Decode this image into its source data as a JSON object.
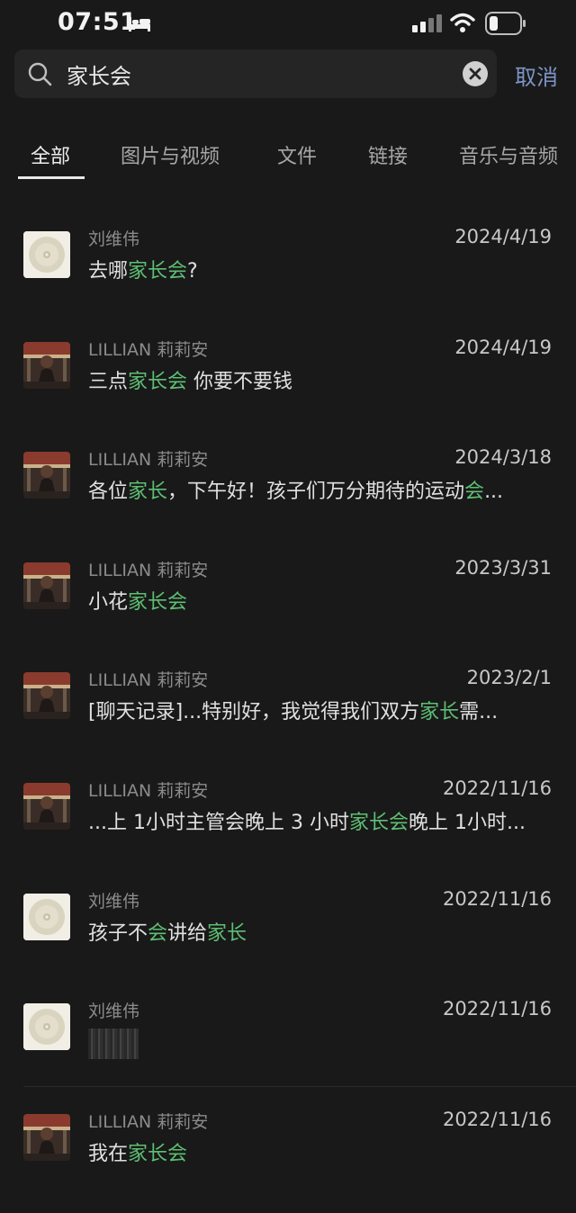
{
  "status_bar": {
    "time": "07:51"
  },
  "search": {
    "query": "家长会",
    "cancel_label": "取消"
  },
  "tabs": [
    {
      "label": "全部",
      "active": true
    },
    {
      "label": "图片与视频",
      "active": false
    },
    {
      "label": "文件",
      "active": false
    },
    {
      "label": "链接",
      "active": false
    },
    {
      "label": "音乐与音频",
      "active": false
    }
  ],
  "colors": {
    "background": "#191919",
    "highlight": "#5dbf73",
    "cancel": "#7c95c6"
  },
  "results": [
    {
      "sender": "刘维伟",
      "date": "2024/4/19",
      "avatar": "disc",
      "snippet": [
        {
          "t": "去哪"
        },
        {
          "t": "家长会",
          "hl": true
        },
        {
          "t": "?"
        }
      ]
    },
    {
      "sender": "LILLIAN 莉莉安",
      "date": "2024/4/19",
      "avatar": "photo",
      "snippet": [
        {
          "t": "三点"
        },
        {
          "t": "家长会",
          "hl": true
        },
        {
          "t": " 你要不要钱"
        }
      ]
    },
    {
      "sender": "LILLIAN 莉莉安",
      "date": "2024/3/18",
      "avatar": "photo",
      "snippet": [
        {
          "t": "各位"
        },
        {
          "t": "家长",
          "hl": true
        },
        {
          "t": "，下午好！孩子们万分期待的运动"
        },
        {
          "t": "会",
          "hl": true
        },
        {
          "t": "..."
        }
      ]
    },
    {
      "sender": "LILLIAN 莉莉安",
      "date": "2023/3/31",
      "avatar": "photo",
      "snippet": [
        {
          "t": "小花"
        },
        {
          "t": "家长会",
          "hl": true
        }
      ]
    },
    {
      "sender": "LILLIAN 莉莉安",
      "date": "2023/2/1",
      "avatar": "photo",
      "snippet": [
        {
          "t": "[聊天记录]...特别好，我觉得我们双方"
        },
        {
          "t": "家长",
          "hl": true
        },
        {
          "t": "需..."
        }
      ]
    },
    {
      "sender": "LILLIAN 莉莉安",
      "date": "2022/11/16",
      "avatar": "photo",
      "snippet": [
        {
          "t": "...上 1小时主管会晚上 3 小时"
        },
        {
          "t": "家长会",
          "hl": true
        },
        {
          "t": "晚上 1小时..."
        }
      ]
    },
    {
      "sender": "刘维伟",
      "date": "2022/11/16",
      "avatar": "disc",
      "snippet": [
        {
          "t": "孩子不"
        },
        {
          "t": "会",
          "hl": true
        },
        {
          "t": "讲给"
        },
        {
          "t": "家长",
          "hl": true
        }
      ]
    },
    {
      "sender": "刘维伟",
      "date": "2022/11/16",
      "avatar": "disc",
      "redacted": true,
      "snippet": []
    },
    {
      "sender": "LILLIAN 莉莉安",
      "date": "2022/11/16",
      "avatar": "photo",
      "snippet": [
        {
          "t": "我在"
        },
        {
          "t": "家长会",
          "hl": true
        }
      ]
    }
  ]
}
